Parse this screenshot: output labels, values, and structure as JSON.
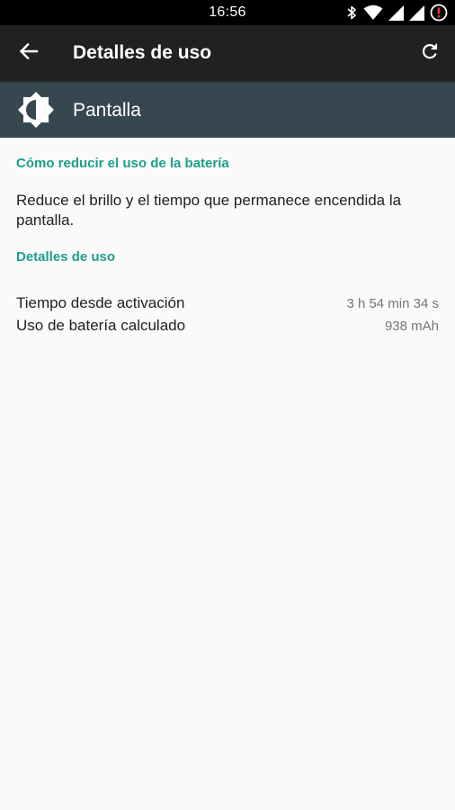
{
  "status_bar": {
    "time": "16:56",
    "icons": [
      "bluetooth-icon",
      "wifi-icon",
      "signal-icon",
      "signal-icon",
      "battery-alert-icon"
    ]
  },
  "toolbar": {
    "title": "Detalles de uso",
    "back_icon": "arrow-back-icon",
    "refresh_icon": "refresh-icon"
  },
  "app": {
    "name": "Pantalla",
    "icon": "brightness-icon"
  },
  "tip_section": {
    "title": "Cómo reducir el uso de la batería",
    "text": "Reduce el brillo y el tiempo que permanece encendida la pantalla."
  },
  "details_section": {
    "title": "Detalles de uso",
    "rows": [
      {
        "label": "Tiempo desde activación",
        "value": "3 h 54 min 34 s"
      },
      {
        "label": "Uso de batería calculado",
        "value": "938 mAh"
      }
    ]
  },
  "colors": {
    "accent": "#1e9e8c",
    "toolbar": "#212121",
    "app_header": "#37474f",
    "background": "#fafafa"
  }
}
